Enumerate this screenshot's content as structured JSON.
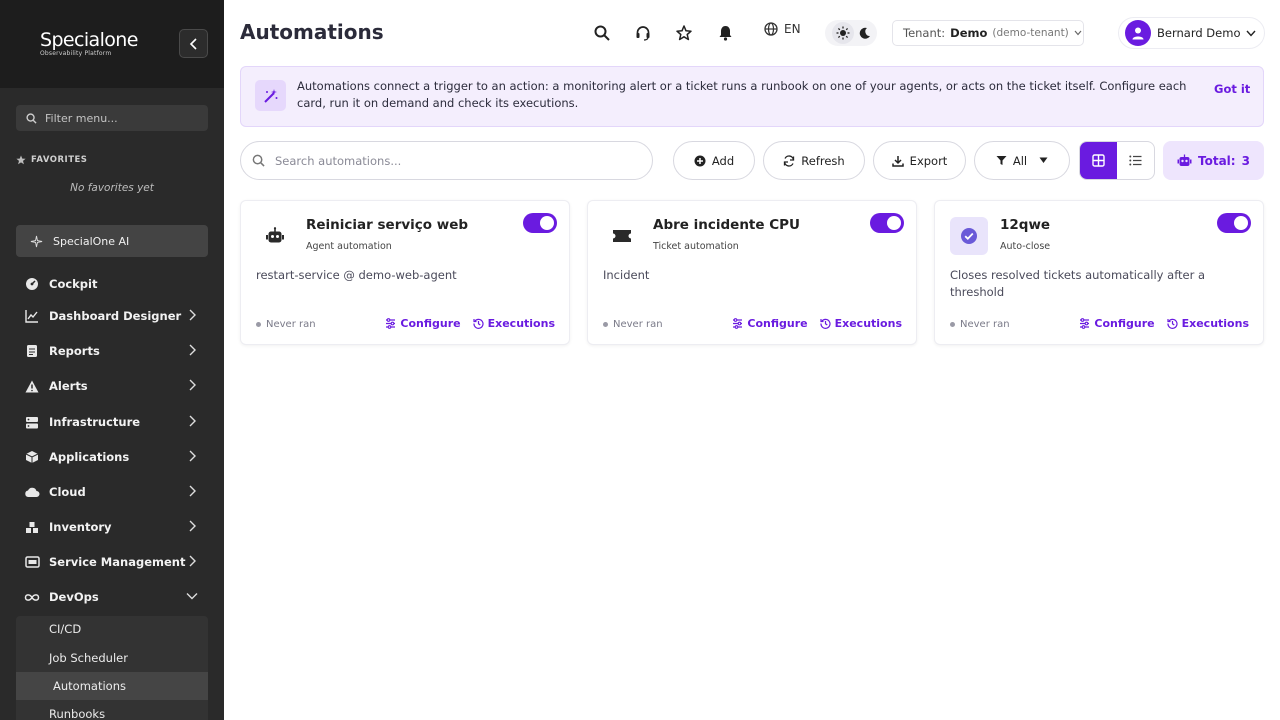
{
  "brand": {
    "name": "Specialone",
    "tagline": "Observability Platform"
  },
  "sidebar": {
    "filter_placeholder": "Filter menu...",
    "favorites_title": "FAVORITES",
    "favorites_empty": "No favorites yet",
    "ai_label": "SpecialOne AI",
    "items": [
      {
        "label": "Cockpit",
        "icon": "cockpit-icon"
      },
      {
        "label": "Dashboard Designer",
        "icon": "chart-icon"
      },
      {
        "label": "Reports",
        "icon": "report-icon"
      },
      {
        "label": "Alerts",
        "icon": "alert-icon"
      },
      {
        "label": "Infrastructure",
        "icon": "server-icon"
      },
      {
        "label": "Applications",
        "icon": "package-icon"
      },
      {
        "label": "Cloud",
        "icon": "cloud-icon"
      },
      {
        "label": "Inventory",
        "icon": "inventory-icon"
      },
      {
        "label": "Service Management",
        "icon": "service-icon"
      },
      {
        "label": "DevOps",
        "icon": "infinity-icon"
      }
    ],
    "devops_sub": [
      {
        "label": "CI/CD"
      },
      {
        "label": "Job Scheduler"
      },
      {
        "label": "Automations"
      },
      {
        "label": "Runbooks"
      }
    ]
  },
  "header": {
    "title": "Automations",
    "lang": "EN",
    "tenant_label": "Tenant:",
    "tenant_name": "Demo",
    "tenant_code": "(demo-tenant)",
    "user_name": "Bernard Demo"
  },
  "banner": {
    "text": "Automations connect a trigger to an action: a monitoring alert or a ticket runs a runbook on one of your agents, or acts on the ticket itself. Configure each card, run it on demand and check its executions.",
    "button": "Got it"
  },
  "toolbar": {
    "search_placeholder": "Search automations...",
    "add": "Add",
    "refresh": "Refresh",
    "export": "Export",
    "filter": "All",
    "total_label": "Total:",
    "total_value": "3"
  },
  "cards": [
    {
      "title": "Reiniciar serviço web",
      "type": "Agent automation",
      "desc": "restart-service @ demo-web-agent",
      "status": "Never ran",
      "configure": "Configure",
      "executions": "Executions",
      "enabled": true,
      "icon": "robot-icon"
    },
    {
      "title": "Abre incidente CPU",
      "type": "Ticket automation",
      "desc": "Incident",
      "status": "Never ran",
      "configure": "Configure",
      "executions": "Executions",
      "enabled": true,
      "icon": "ticket-icon"
    },
    {
      "title": "12qwe",
      "type": "Auto-close",
      "desc": "Closes resolved tickets automatically after a threshold",
      "status": "Never ran",
      "configure": "Configure",
      "executions": "Executions",
      "enabled": true,
      "icon": "check-circle-icon"
    }
  ],
  "colors": {
    "accent": "#6a1be0",
    "sidebar_bg": "#2a2a2a",
    "banner_bg": "#f4eefd"
  }
}
